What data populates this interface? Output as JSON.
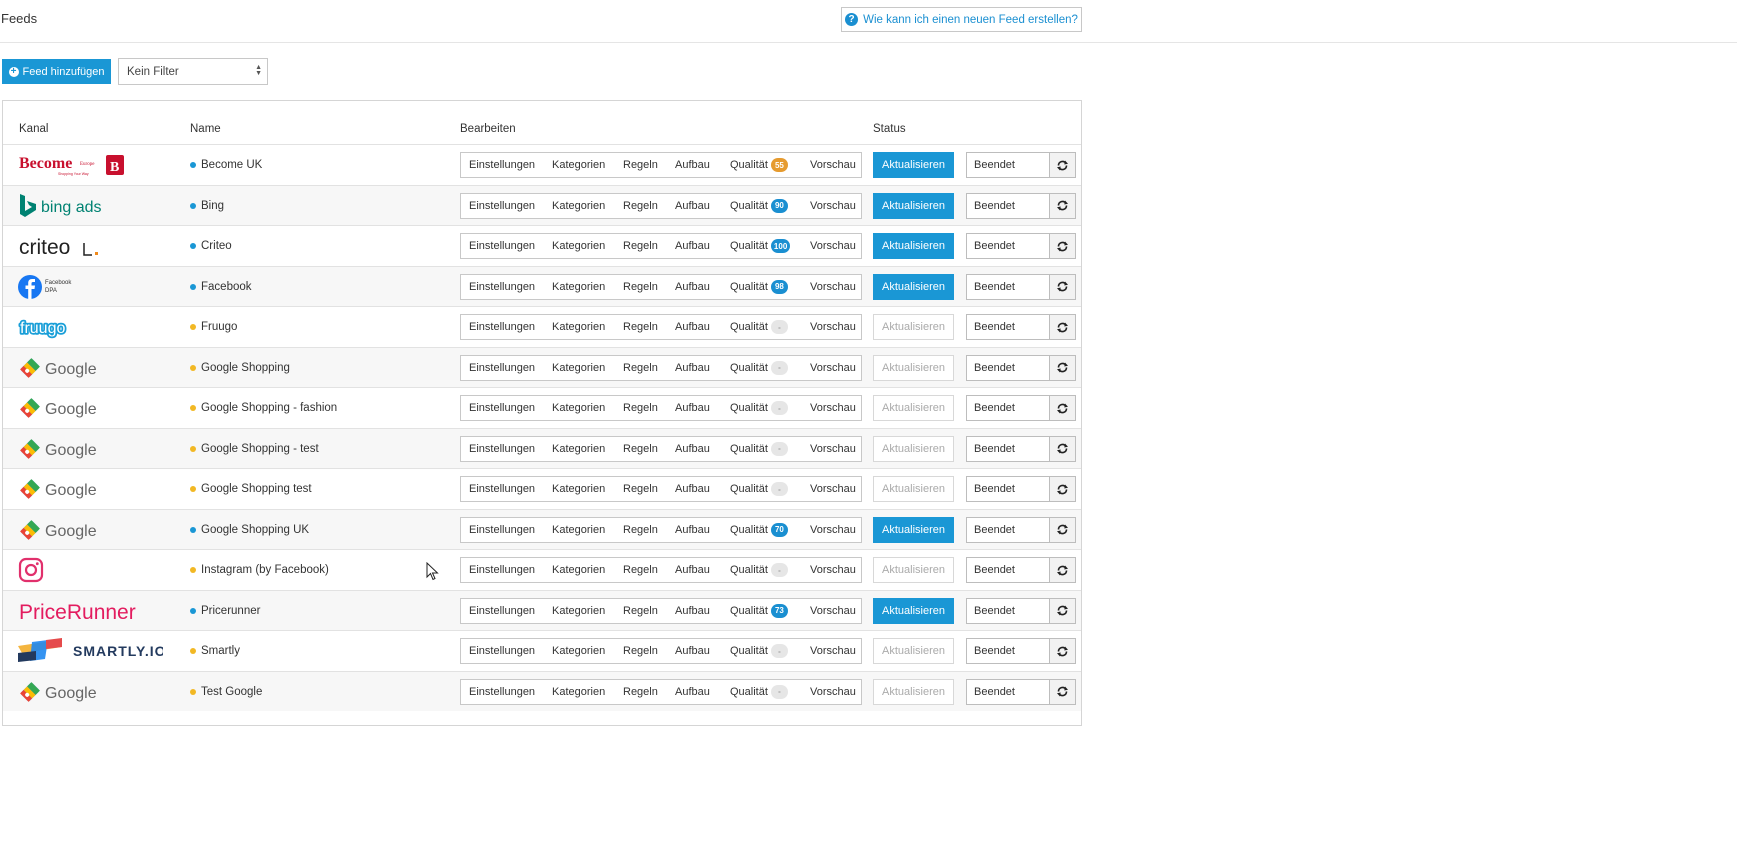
{
  "header": {
    "title": "Feeds",
    "help_label": "Wie kann ich einen neuen Feed erstellen?"
  },
  "toolbar": {
    "add_label": "Feed hinzufügen",
    "filter_value": "Kein Filter"
  },
  "columns": {
    "channel": "Kanal",
    "name": "Name",
    "edit": "Bearbeiten",
    "status": "Status"
  },
  "actions": {
    "settings": "Einstellungen",
    "categories": "Kategorien",
    "rules": "Regeln",
    "structure": "Aufbau",
    "quality": "Qualität",
    "preview": "Vorschau",
    "update": "Aktualisieren",
    "finished": "Beendet"
  },
  "colors": {
    "active_dot": "#1a97d5",
    "inactive_dot": "#f2b824",
    "accent": "#1a97d5"
  },
  "feeds": [
    {
      "channel": "become",
      "logo_text": "Become",
      "logo_small": "Europe",
      "logo_sub": "Shopping Your Way",
      "logo_mark": "B",
      "name": "Become UK",
      "active": true,
      "quality": "55",
      "quality_color": "#e69b2f"
    },
    {
      "channel": "bing",
      "logo_text": "bing ads",
      "name": "Bing",
      "active": true,
      "quality": "90",
      "quality_color": "#1a8fd1"
    },
    {
      "channel": "criteo",
      "logo_text": "criteo",
      "name": "Criteo",
      "active": true,
      "quality": "100",
      "quality_color": "#1a8fd1"
    },
    {
      "channel": "facebook",
      "logo_text": "Facebook",
      "logo_sub": "DPA",
      "name": "Facebook",
      "active": true,
      "quality": "98",
      "quality_color": "#1a8fd1"
    },
    {
      "channel": "fruugo",
      "logo_text": "fruugo",
      "name": "Fruugo",
      "active": false,
      "quality": "-",
      "quality_color": "#e6e6e6"
    },
    {
      "channel": "google",
      "logo_text": "Google",
      "name": "Google Shopping",
      "active": false,
      "quality": "-",
      "quality_color": "#e6e6e6"
    },
    {
      "channel": "google",
      "logo_text": "Google",
      "name": "Google Shopping - fashion",
      "active": false,
      "quality": "-",
      "quality_color": "#e6e6e6"
    },
    {
      "channel": "google",
      "logo_text": "Google",
      "name": "Google Shopping - test",
      "active": false,
      "quality": "-",
      "quality_color": "#e6e6e6"
    },
    {
      "channel": "google",
      "logo_text": "Google",
      "name": "Google Shopping test",
      "active": false,
      "quality": "-",
      "quality_color": "#e6e6e6"
    },
    {
      "channel": "google",
      "logo_text": "Google",
      "name": "Google Shopping UK",
      "active": true,
      "quality": "70",
      "quality_color": "#1a8fd1"
    },
    {
      "channel": "instagram",
      "logo_text": "",
      "name": "Instagram (by Facebook)",
      "active": false,
      "quality": "-",
      "quality_color": "#e6e6e6"
    },
    {
      "channel": "pricerunner",
      "logo_text": "PriceRunner",
      "name": "Pricerunner",
      "active": true,
      "quality": "73",
      "quality_color": "#1a8fd1"
    },
    {
      "channel": "smartly",
      "logo_text": "SMARTLY.IO",
      "name": "Smartly",
      "active": false,
      "quality": "-",
      "quality_color": "#e6e6e6"
    },
    {
      "channel": "google",
      "logo_text": "Google",
      "name": "Test Google",
      "active": false,
      "quality": "-",
      "quality_color": "#e6e6e6"
    }
  ]
}
